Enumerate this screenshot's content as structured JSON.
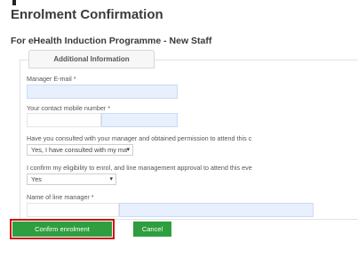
{
  "page": {
    "title": "Enrolment Confirmation",
    "subtitle": "For eHealth Induction Programme - New Staff"
  },
  "section": {
    "tab_label": "Additional Information"
  },
  "form": {
    "manager_email_label": "Manager E-mail *",
    "contact_mobile_label": "Your contact mobile number *",
    "consulted_label": "Have you consulted with your manager and obtained permission to attend this c",
    "consulted_value": "Yes, I have consulted with my ma",
    "eligibility_label": "I confirm my eligibility to enrol, and line management approval to attend this eve",
    "eligibility_value": "Yes",
    "line_manager_label": "Name of line manager *"
  },
  "buttons": {
    "confirm_label": "Confirm enrolment",
    "cancel_label": "Cancel"
  },
  "colors": {
    "button_green": "#2e9e3e",
    "highlight_red": "#d01010",
    "input_fill_blue": "#e8f0fe"
  }
}
